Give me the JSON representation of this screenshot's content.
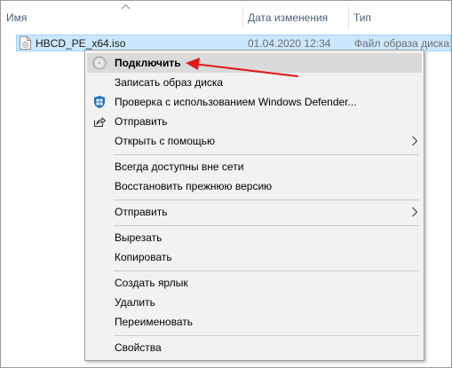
{
  "header": {
    "col_name": "Имя",
    "col_date": "Дата изменения",
    "col_type": "Тип"
  },
  "file": {
    "name": "HBCD_PE_x64.iso",
    "date": "01.04.2020 12:34",
    "type": "Файл образа диска"
  },
  "menu": {
    "items": [
      {
        "label": "Подключить",
        "icon": "disc-icon",
        "default": true,
        "highlighted": true
      },
      {
        "label": "Записать образ диска"
      },
      {
        "label": "Проверка с использованием Windows Defender...",
        "icon": "windows-defender-icon"
      },
      {
        "label": "Отправить",
        "icon": "share-icon"
      },
      {
        "label": "Открыть с помощью",
        "submenu": true
      },
      {
        "label": "Всегда доступны вне сети"
      },
      {
        "label": "Восстановить прежнюю версию"
      },
      {
        "label": "Отправить",
        "submenu": true
      },
      {
        "label": "Вырезать"
      },
      {
        "label": "Копировать"
      },
      {
        "label": "Создать ярлык"
      },
      {
        "label": "Удалить"
      },
      {
        "label": "Переименовать"
      },
      {
        "label": "Свойства"
      }
    ]
  },
  "colors": {
    "selection_bg": "#cce8ff",
    "menu_bg": "#f2f2f2",
    "menu_highlight": "#dadada",
    "annotation_arrow": "#e0191a",
    "defender_blue": "#1f6fbf"
  }
}
